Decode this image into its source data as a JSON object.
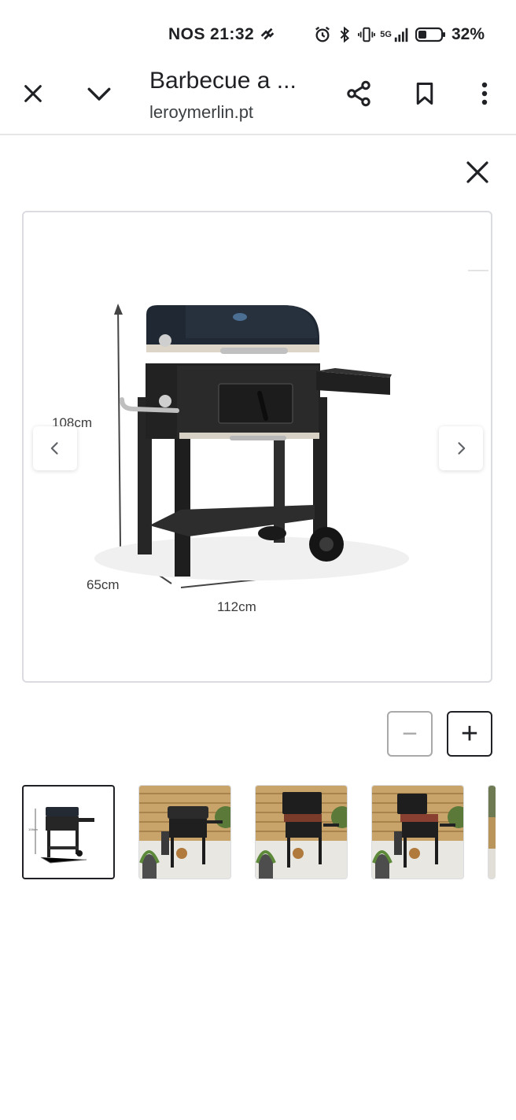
{
  "status_bar": {
    "carrier": "NOS",
    "time": "21:32",
    "battery_percent": "32%",
    "network": "5G",
    "icons": [
      "alarm-icon",
      "bluetooth-icon",
      "vibrate-icon",
      "signal-icon",
      "battery-icon"
    ]
  },
  "toolbar": {
    "title": "Barbecue a ...",
    "url": "leroymerlin.pt",
    "icons": [
      "close-icon",
      "chevron-down-icon",
      "share-icon",
      "bookmark-icon",
      "more-vert-icon"
    ]
  },
  "viewer": {
    "dimensions": {
      "height_label": "108cm",
      "depth_label": "65cm",
      "width_label": "112cm"
    },
    "zoom": {
      "out_label": "−",
      "in_label": "+"
    },
    "thumbnails": [
      {
        "selected": true,
        "kind": "product-dimensions"
      },
      {
        "selected": false,
        "kind": "lifestyle-closed-lid"
      },
      {
        "selected": false,
        "kind": "lifestyle-open-lid"
      },
      {
        "selected": false,
        "kind": "lifestyle-open-lid"
      },
      {
        "selected": false,
        "kind": "lifestyle-partial"
      }
    ],
    "colors": {
      "accent": "#202124",
      "border": "#dadce0",
      "grill": "#2a2a2a",
      "wood": "#c9a46a"
    }
  }
}
